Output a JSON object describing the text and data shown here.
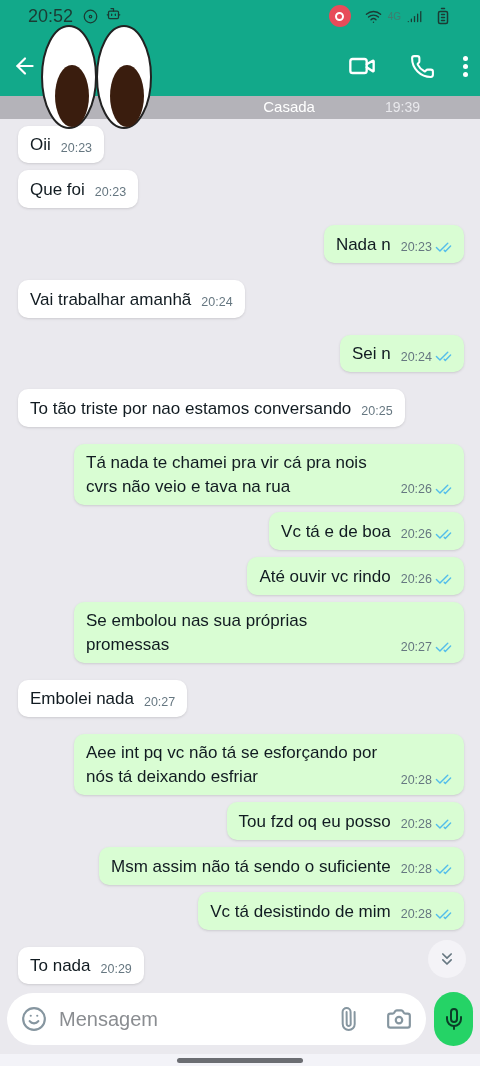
{
  "status_bar": {
    "time": "20:52",
    "network": "4G"
  },
  "header": {
    "pinned_hint": "Casada",
    "pinned_time": "19:39"
  },
  "messages": [
    {
      "sent": false,
      "text": "Oii",
      "time": "20:23"
    },
    {
      "sent": false,
      "text": "Que foi",
      "time": "20:23"
    },
    {
      "sent": true,
      "text": "Nada n",
      "time": "20:23",
      "read": true
    },
    {
      "sent": false,
      "text": "Vai trabalhar amanhã",
      "time": "20:24"
    },
    {
      "sent": true,
      "text": "Sei n",
      "time": "20:24",
      "read": true
    },
    {
      "sent": false,
      "text": "To tão triste por nao estamos conversando",
      "time": "20:25"
    },
    {
      "sent": true,
      "text": "Tá nada te chamei pra vir cá pra nois cvrs não veio e tava na rua",
      "time": "20:26",
      "read": true
    },
    {
      "sent": true,
      "text": "Vc tá e de boa",
      "time": "20:26",
      "read": true
    },
    {
      "sent": true,
      "text": "Até ouvir vc rindo",
      "time": "20:26",
      "read": true
    },
    {
      "sent": true,
      "text": "Se embolou nas sua próprias promessas",
      "time": "20:27",
      "read": true
    },
    {
      "sent": false,
      "text": "Embolei nada",
      "time": "20:27"
    },
    {
      "sent": true,
      "text": "Aee int pq vc não tá se esforçando por nós tá deixando esfriar",
      "time": "20:28",
      "read": true
    },
    {
      "sent": true,
      "text": "Tou fzd oq eu posso",
      "time": "20:28",
      "read": true
    },
    {
      "sent": true,
      "text": "Msm assim não tá sendo o suficiente",
      "time": "20:28",
      "read": true
    },
    {
      "sent": true,
      "text": "Vc tá desistindo de mim",
      "time": "20:28",
      "read": true
    },
    {
      "sent": false,
      "text": "To nada",
      "time": "20:29"
    }
  ],
  "composer": {
    "placeholder": "Mensagem"
  }
}
